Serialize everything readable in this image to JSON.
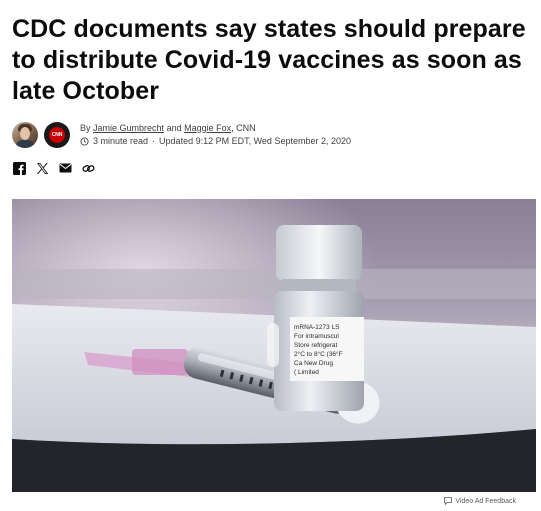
{
  "article": {
    "headline": "CDC documents say states should prepare to distribute Covid-19 vaccines as soon as late October"
  },
  "byline": {
    "prefix": "By",
    "author1": "Jamie Gumbrecht",
    "and": "and",
    "author2": "Maggie Fox",
    "outlet": ", CNN",
    "logo_text": "CNN",
    "read_time": "3 minute read",
    "separator": "·",
    "updated": "Updated 9:12 PM EDT, Wed September 2, 2020"
  },
  "share": {
    "icons": [
      "facebook-icon",
      "x-icon",
      "email-icon",
      "link-icon"
    ]
  },
  "video": {
    "label_lines": [
      "mRNA-1273 LS",
      "For intramuscul",
      "Store refrigerat",
      "2°C to 8°C (36°F",
      "Ca     New Drug",
      "(         Limited"
    ]
  },
  "feedback": {
    "label": "Video Ad Feedback"
  },
  "colors": {
    "brand_red": "#cc0000",
    "text": "#0c0c0c",
    "meta": "#404040"
  }
}
